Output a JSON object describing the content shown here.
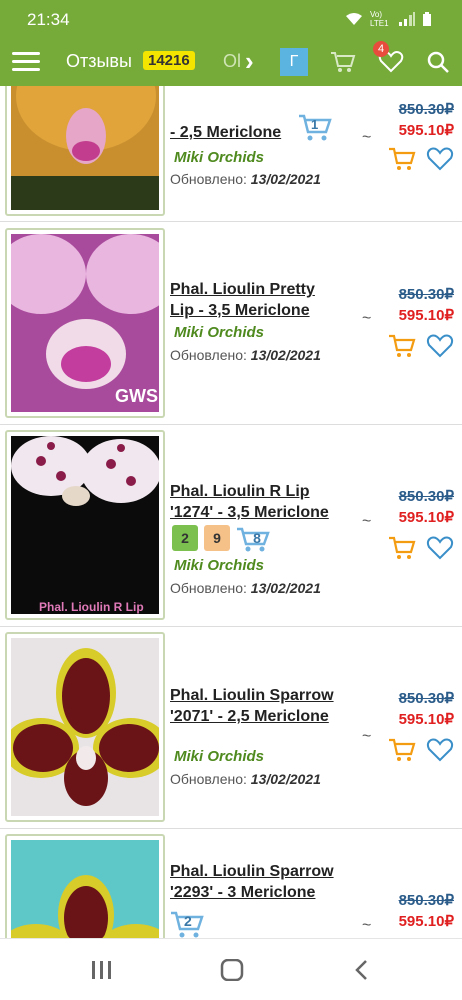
{
  "status": {
    "time": "21:34",
    "network": "Vo) LTE1"
  },
  "appbar": {
    "reviews_label": "Отзывы",
    "reviews_count": "14216",
    "next_tab": "Ol",
    "letter_button": "Г",
    "wishlist_badge": "4"
  },
  "items": [
    {
      "title": "- 2,5 Mericlone",
      "stats": [
        {
          "kind": "cart",
          "value": "1"
        }
      ],
      "seller": "Miki Orchids",
      "updated_label": "Обновлено:",
      "updated_date": "13/02/2021",
      "tilde": "~",
      "old_price": "850.30₽",
      "new_price": "595.10₽"
    },
    {
      "title": "Phal. Lioulin Pretty Lip - 3,5 Mericlone",
      "stats": [],
      "seller": "Miki Orchids",
      "updated_label": "Обновлено:",
      "updated_date": "13/02/2021",
      "tilde": "~",
      "old_price": "850.30₽",
      "new_price": "595.10₽",
      "image_watermark": "GWS"
    },
    {
      "title": "Phal. Lioulin R Lip '1274' - 3,5 Mericlone",
      "stats": [
        {
          "kind": "comment",
          "value": "2"
        },
        {
          "kind": "bag",
          "value": "9"
        },
        {
          "kind": "cart",
          "value": "8"
        }
      ],
      "seller": "Miki Orchids",
      "updated_label": "Обновлено:",
      "updated_date": "13/02/2021",
      "tilde": "~",
      "old_price": "850.30₽",
      "new_price": "595.10₽",
      "image_watermark": "Phal. Lioulin R Lip"
    },
    {
      "title": "Phal. Lioulin Sparrow '2071' - 2,5 Mericlone",
      "stats": [],
      "seller": "Miki Orchids",
      "updated_label": "Обновлено:",
      "updated_date": "13/02/2021",
      "tilde": "~",
      "old_price": "850.30₽",
      "new_price": "595.10₽"
    },
    {
      "title": "Phal. Lioulin Sparrow '2293' - 3 Mericlone",
      "stats": [
        {
          "kind": "cart",
          "value": "2"
        }
      ],
      "seller": "",
      "updated_label": "",
      "updated_date": "",
      "tilde": "~",
      "old_price": "850.30₽",
      "new_price": "595.10₽"
    }
  ],
  "colors": {
    "brand_green": "#76ab3a",
    "price_red": "#e02020",
    "old_price_blue": "#2b5c8a",
    "seller_green": "#4f8a1f",
    "icon_orange": "#f39c12",
    "icon_blue": "#3a8fc9"
  }
}
